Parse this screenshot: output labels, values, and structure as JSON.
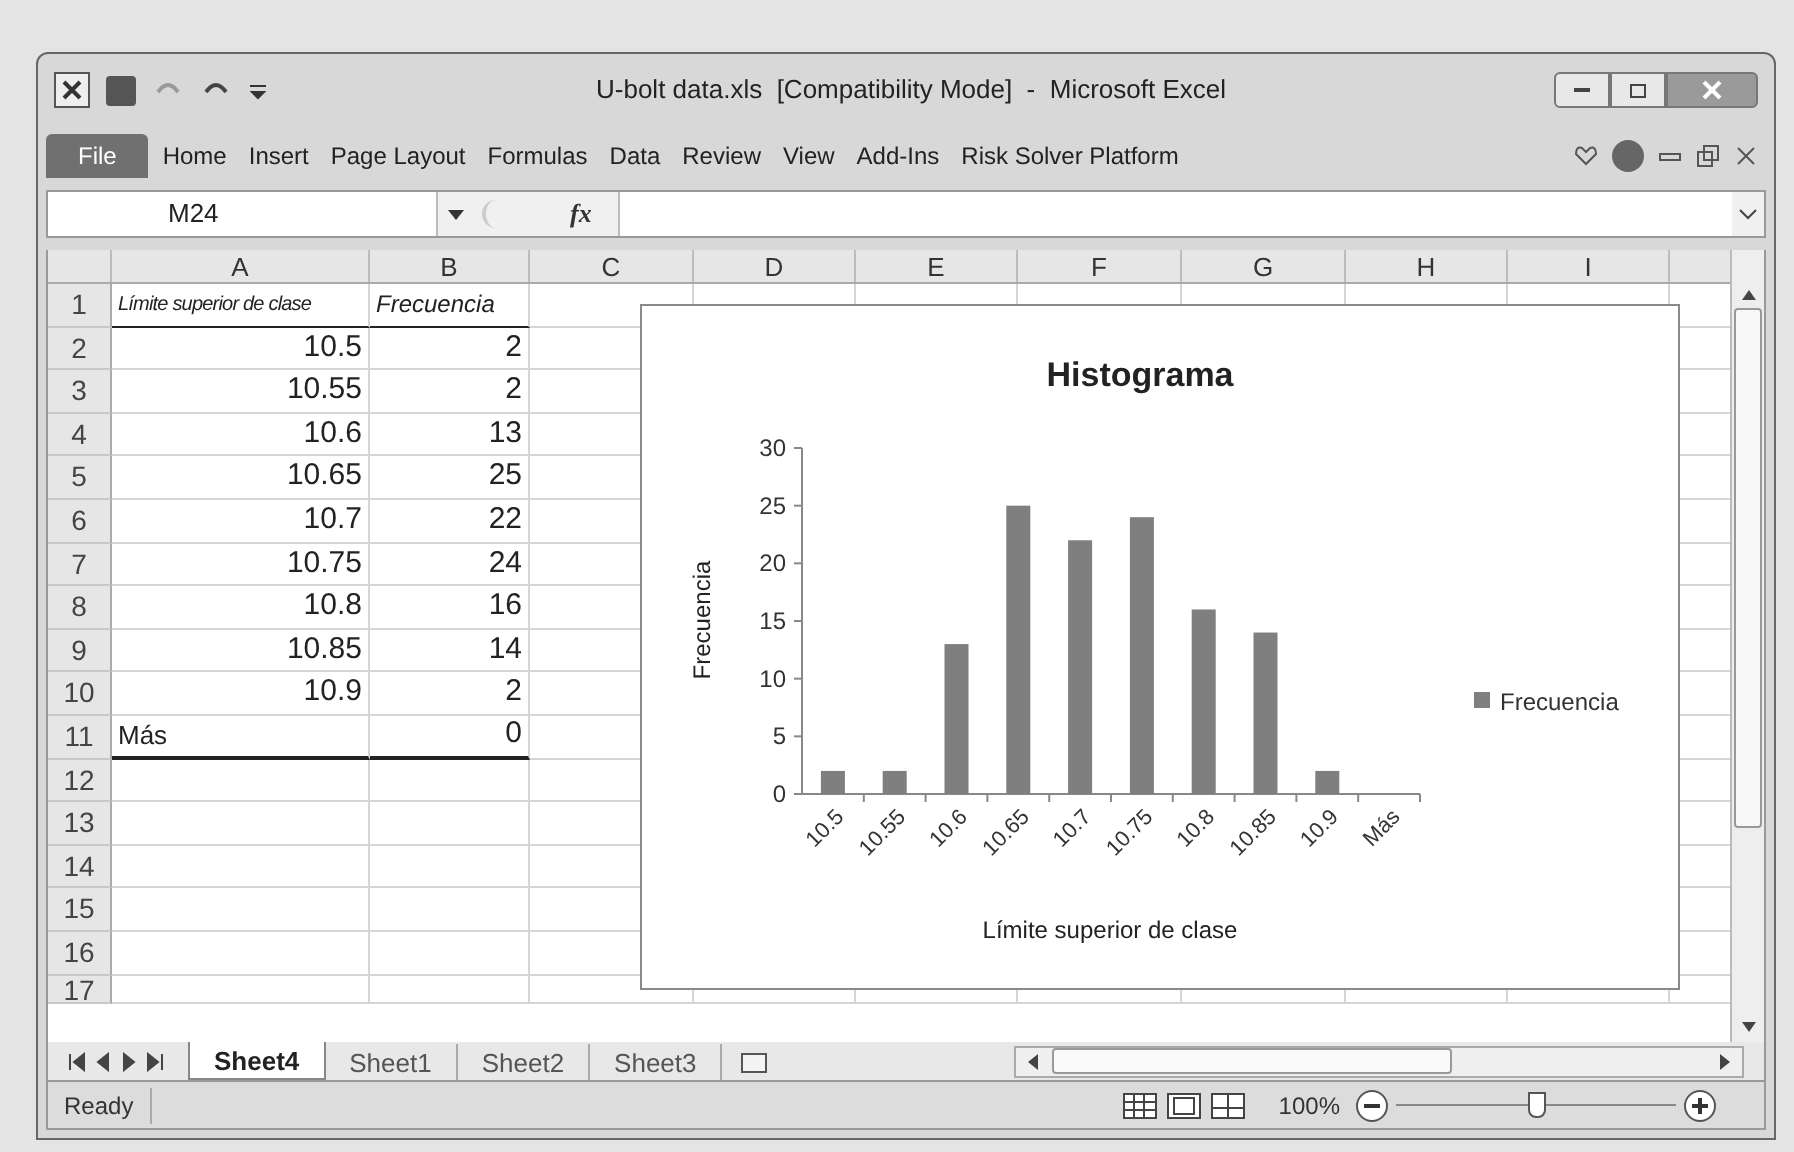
{
  "window": {
    "title": "U-bolt data.xls  [Compatibility Mode]  -  Microsoft Excel"
  },
  "ribbon_tabs": [
    {
      "label": "File",
      "selected": true
    },
    {
      "label": "Home",
      "selected": false
    },
    {
      "label": "Insert",
      "selected": false
    },
    {
      "label": "Page Layout",
      "selected": false
    },
    {
      "label": "Formulas",
      "selected": false
    },
    {
      "label": "Data",
      "selected": false
    },
    {
      "label": "Review",
      "selected": false
    },
    {
      "label": "View",
      "selected": false
    },
    {
      "label": "Add-Ins",
      "selected": false
    },
    {
      "label": "Risk Solver Platform",
      "selected": false
    }
  ],
  "formula_bar": {
    "name_box": "M24",
    "fx": "fx"
  },
  "columns": [
    "A",
    "B",
    "C",
    "D",
    "E",
    "F",
    "G",
    "H",
    "I"
  ],
  "rows": [
    {
      "number": "1",
      "kind": "header",
      "a": "Límite superior de clase",
      "b": "Frecuencia"
    },
    {
      "number": "2",
      "kind": "data",
      "a": "10.5",
      "b": "2"
    },
    {
      "number": "3",
      "kind": "data",
      "a": "10.55",
      "b": "2"
    },
    {
      "number": "4",
      "kind": "data",
      "a": "10.6",
      "b": "13"
    },
    {
      "number": "5",
      "kind": "data",
      "a": "10.65",
      "b": "25"
    },
    {
      "number": "6",
      "kind": "data",
      "a": "10.7",
      "b": "22"
    },
    {
      "number": "7",
      "kind": "data",
      "a": "10.75",
      "b": "24"
    },
    {
      "number": "8",
      "kind": "data",
      "a": "10.8",
      "b": "16"
    },
    {
      "number": "9",
      "kind": "data",
      "a": "10.85",
      "b": "14"
    },
    {
      "number": "10",
      "kind": "data",
      "a": "10.9",
      "b": "2"
    },
    {
      "number": "11",
      "kind": "last",
      "a": "Más",
      "b": "0"
    },
    {
      "number": "12",
      "kind": "empty"
    },
    {
      "number": "13",
      "kind": "empty"
    },
    {
      "number": "14",
      "kind": "empty"
    },
    {
      "number": "15",
      "kind": "empty"
    },
    {
      "number": "16",
      "kind": "empty"
    },
    {
      "number": "17",
      "kind": "empty"
    }
  ],
  "chart": {
    "chart_data": {
      "type": "bar",
      "title": "Histograma",
      "xlabel": "Límite superior de clase",
      "ylabel": "Frecuencia",
      "categories": [
        "10.5",
        "10.55",
        "10.6",
        "10.65",
        "10.7",
        "10.75",
        "10.8",
        "10.85",
        "10.9",
        "Más"
      ],
      "series": [
        {
          "name": "Frecuencia",
          "color": "#7f7f7f",
          "values": [
            2,
            2,
            13,
            25,
            22,
            24,
            16,
            14,
            2,
            0
          ]
        }
      ],
      "ylim": [
        0,
        30
      ],
      "yticks": [
        0,
        5,
        10,
        15,
        20,
        25,
        30
      ]
    }
  },
  "sheet_tabs": [
    {
      "label": "Sheet4",
      "selected": true
    },
    {
      "label": "Sheet1",
      "selected": false
    },
    {
      "label": "Sheet2",
      "selected": false
    },
    {
      "label": "Sheet3",
      "selected": false
    }
  ],
  "status_bar": {
    "status": "Ready",
    "zoom": "100%",
    "zoom_slider": {
      "level": 0.5
    }
  }
}
